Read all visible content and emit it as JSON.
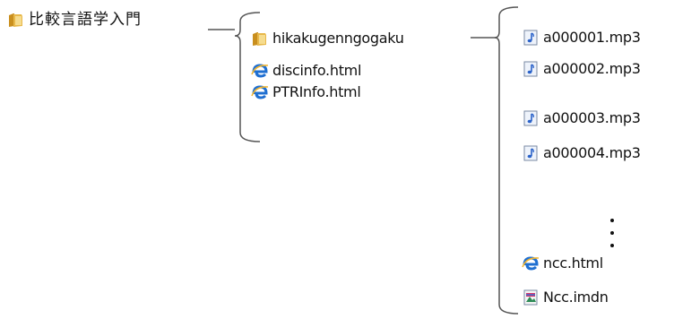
{
  "root": {
    "label": "比較言語学入門",
    "icon": "folder-icon"
  },
  "level1": {
    "folder": {
      "label": "hikakugenngogaku",
      "icon": "folder-icon"
    },
    "files": [
      {
        "label": "discinfo.html",
        "icon": "ie-html-icon"
      },
      {
        "label": "PTRInfo.html",
        "icon": "ie-html-icon"
      }
    ]
  },
  "level2": {
    "files": [
      {
        "label": "a000001.mp3",
        "icon": "audio-file-icon"
      },
      {
        "label": "a000002.mp3",
        "icon": "audio-file-icon"
      },
      {
        "label": "a000003.mp3",
        "icon": "audio-file-icon"
      },
      {
        "label": "a000004.mp3",
        "icon": "audio-file-icon"
      },
      {
        "label": "ncc.html",
        "icon": "ie-html-icon"
      },
      {
        "label": "Ncc.imdn",
        "icon": "image-file-icon"
      }
    ]
  },
  "colors": {
    "folder": "#e8b84a",
    "folder_dark": "#c98f1e",
    "ie_blue": "#1f6fd1",
    "ie_gold": "#f2b632",
    "audio_blue": "#2a62c9",
    "connector": "#555555"
  }
}
